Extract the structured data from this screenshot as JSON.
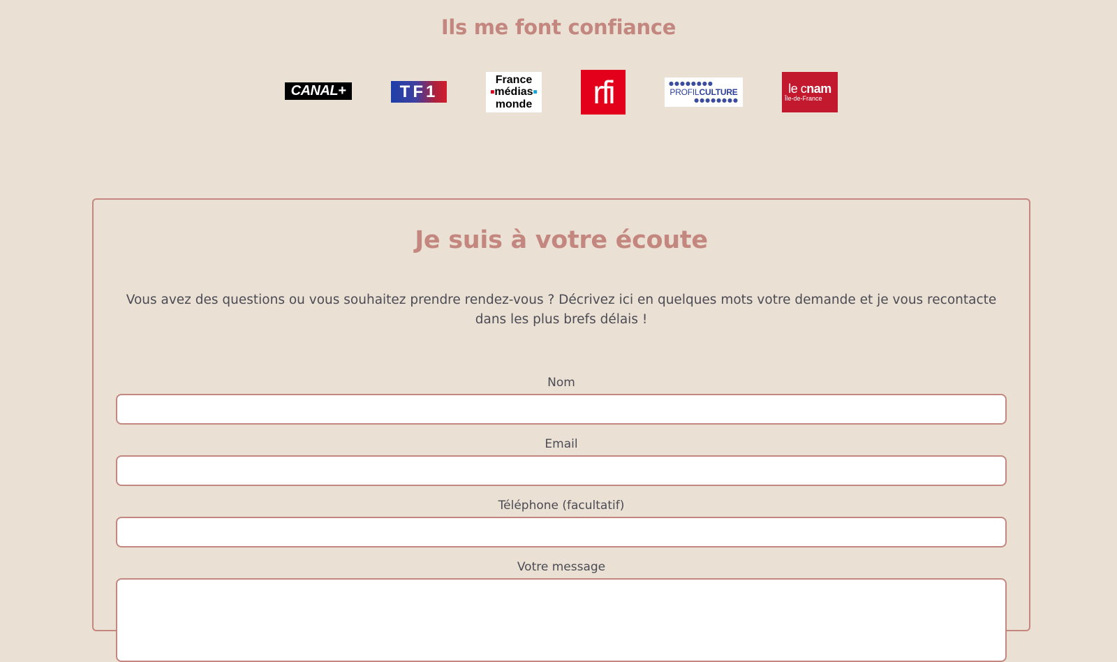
{
  "trust": {
    "title": "Ils me font confiance",
    "logos": [
      {
        "name": "CANAL+",
        "text": "CANAL+"
      },
      {
        "name": "TF1",
        "text": "TF1"
      },
      {
        "name": "France médias monde",
        "line1": "France",
        "line2": "médias",
        "line3": "monde"
      },
      {
        "name": "rfi",
        "text": "rfi"
      },
      {
        "name": "PROFILCULTURE",
        "text_light": "PROFIL",
        "text_bold": "CULTURE"
      },
      {
        "name": "le cnam Île-de-France",
        "light": "le c",
        "bold": "nam",
        "sub": "Île-de-France"
      }
    ]
  },
  "contact": {
    "title": "Je suis à votre écoute",
    "intro": "Vous avez des questions ou vous souhaitez prendre rendez-vous ? Décrivez ici en quelques mots votre demande et je vous recontacte dans les plus brefs délais !",
    "fields": {
      "name": {
        "label": "Nom",
        "value": ""
      },
      "email": {
        "label": "Email",
        "value": ""
      },
      "phone": {
        "label": "Téléphone (facultatif)",
        "value": ""
      },
      "message": {
        "label": "Votre message",
        "value": ""
      }
    }
  },
  "colors": {
    "background": "#eae0d3",
    "accent": "#c4877f",
    "text": "#4b4b55"
  }
}
